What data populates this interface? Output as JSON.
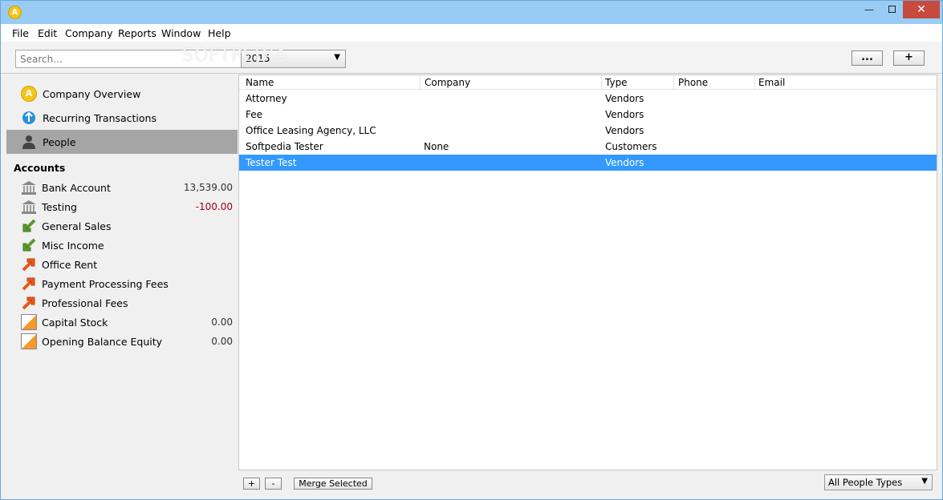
{
  "window": {
    "app_icon": "A",
    "watermark": "SOFTPEDIA"
  },
  "menu": [
    "File",
    "Edit",
    "Company",
    "Reports",
    "Window",
    "Help"
  ],
  "toolbar": {
    "search_placeholder": "Search...",
    "year": "2015",
    "more_label": "...",
    "add_label": "+"
  },
  "sidebar": {
    "nav": [
      {
        "label": "Company Overview",
        "icon": "company-icon"
      },
      {
        "label": "Recurring Transactions",
        "icon": "recurring-icon"
      },
      {
        "label": "People",
        "icon": "person-icon",
        "selected": true
      }
    ],
    "accounts_heading": "Accounts",
    "accounts": [
      {
        "label": "Bank Account",
        "value": "13,539.00",
        "icon": "bank-icon"
      },
      {
        "label": "Testing",
        "value": "-100.00",
        "icon": "bank-icon",
        "negative": true
      },
      {
        "label": "General Sales",
        "value": "",
        "icon": "income-arrow-icon"
      },
      {
        "label": "Misc Income",
        "value": "",
        "icon": "income-arrow-icon"
      },
      {
        "label": "Office Rent",
        "value": "",
        "icon": "expense-arrow-icon"
      },
      {
        "label": "Payment Processing Fees",
        "value": "",
        "icon": "expense-arrow-icon"
      },
      {
        "label": "Professional Fees",
        "value": "",
        "icon": "expense-arrow-icon"
      },
      {
        "label": "Capital Stock",
        "value": "0.00",
        "icon": "equity-icon"
      },
      {
        "label": "Opening Balance Equity",
        "value": "0.00",
        "icon": "equity-icon"
      }
    ]
  },
  "table": {
    "columns": [
      "Name",
      "Company",
      "Type",
      "Phone",
      "Email"
    ],
    "rows": [
      {
        "name": "Attorney",
        "company": "",
        "type": "Vendors",
        "phone": "",
        "email": ""
      },
      {
        "name": "Fee",
        "company": "",
        "type": "Vendors",
        "phone": "",
        "email": ""
      },
      {
        "name": "Office Leasing Agency, LLC",
        "company": "",
        "type": "Vendors",
        "phone": "",
        "email": ""
      },
      {
        "name": "Softpedia Tester",
        "company": "None",
        "type": "Customers",
        "phone": "",
        "email": ""
      },
      {
        "name": "Tester Test",
        "company": "",
        "type": "Vendors",
        "phone": "",
        "email": "",
        "selected": true
      }
    ]
  },
  "bottom": {
    "add_label": "+",
    "remove_label": "-",
    "merge_label": "Merge Selected",
    "filter": "All People Types"
  },
  "colors": {
    "titlebar": "#99ccf4",
    "selection": "#3399ff",
    "nav_selected": "#a5a5a5",
    "negative": "#a0001a"
  }
}
